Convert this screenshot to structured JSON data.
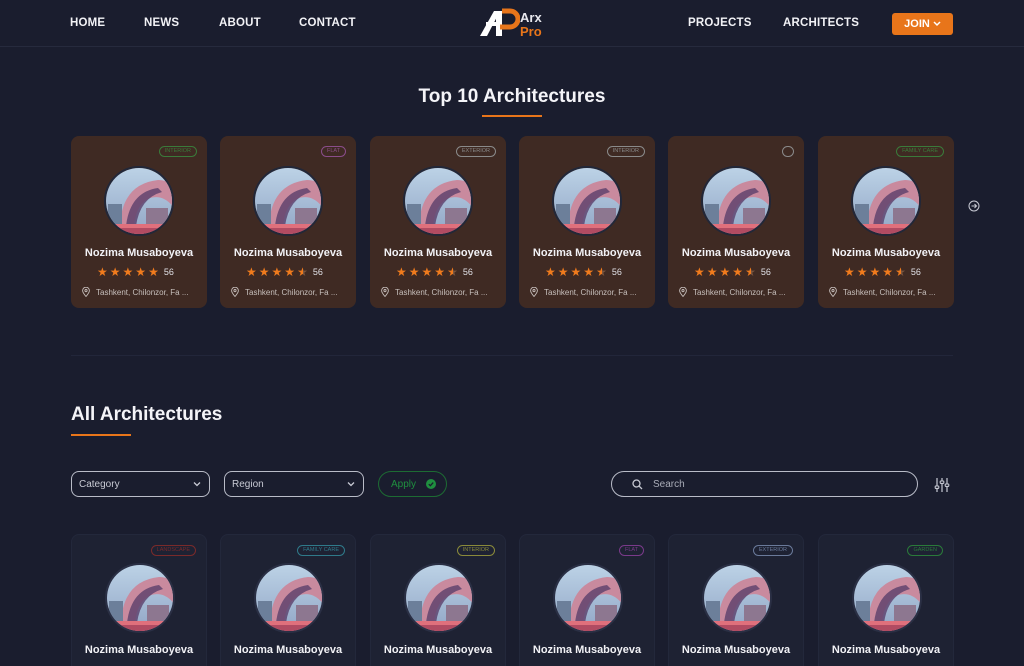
{
  "nav": {
    "left": [
      "HOME",
      "NEWS",
      "ABOUT",
      "CONTACT"
    ],
    "right": [
      "PROJECTS",
      "ARCHITECTS"
    ],
    "join_label": "JOIN"
  },
  "logo": {
    "line1": "Arx",
    "line2": "Pro"
  },
  "top_section": {
    "title": "Top 10 Architectures",
    "cards": [
      {
        "tag": "interior",
        "tag_color": "#3a7a3a",
        "name": "Nozima Musaboyeva",
        "rating": 5,
        "count": "56",
        "location": "Tashkent, Chilonzor, Fa ..."
      },
      {
        "tag": "flat",
        "tag_color": "#8a4d8a",
        "name": "Nozima Musaboyeva",
        "rating": 4.5,
        "count": "56",
        "location": "Tashkent, Chilonzor, Fa ..."
      },
      {
        "tag": "exterior",
        "tag_color": "#8a8a8a",
        "name": "Nozima Musaboyeva",
        "rating": 4.5,
        "count": "56",
        "location": "Tashkent, Chilonzor, Fa ..."
      },
      {
        "tag": "interior",
        "tag_color": "#8a8a8a",
        "name": "Nozima Musaboyeva",
        "rating": 4.5,
        "count": "56",
        "location": "Tashkent, Chilonzor, Fa ..."
      },
      {
        "tag": "",
        "tag_color": "#8a8a8a",
        "name": "Nozima Musaboyeva",
        "rating": 4.5,
        "count": "56",
        "location": "Tashkent, Chilonzor, Fa ..."
      },
      {
        "tag": "family care",
        "tag_color": "#3a7a3a",
        "name": "Nozima Musaboyeva",
        "rating": 4.5,
        "count": "56",
        "location": "Tashkent, Chilonzor, Fa ..."
      }
    ]
  },
  "all_section": {
    "title": "All Architectures",
    "filters": {
      "category_placeholder": "Category",
      "region_placeholder": "Region",
      "apply_label": "Apply",
      "search_placeholder": "Search"
    },
    "cards": [
      {
        "tag": "landscape",
        "tag_color": "#7a2a2a",
        "name": "Nozima Musaboyeva"
      },
      {
        "tag": "family care",
        "tag_color": "#2f7a8a",
        "name": "Nozima Musaboyeva"
      },
      {
        "tag": "interior",
        "tag_color": "#8a8a3a",
        "name": "Nozima Musaboyeva"
      },
      {
        "tag": "flat",
        "tag_color": "#7a3a8a",
        "name": "Nozima Musaboyeva"
      },
      {
        "tag": "exterior",
        "tag_color": "#6a7a9a",
        "name": "Nozima Musaboyeva"
      },
      {
        "tag": "garden",
        "tag_color": "#2a7a3a",
        "name": "Nozima Musaboyeva"
      }
    ]
  },
  "colors": {
    "accent": "#e8751a",
    "background": "#1a1d2e",
    "card_top": "#3f2a23",
    "apply": "#1f8f3f"
  }
}
